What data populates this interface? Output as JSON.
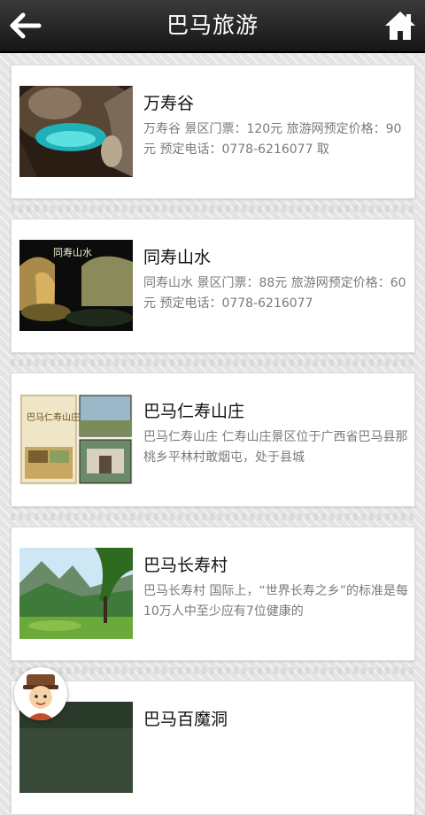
{
  "header": {
    "title": "巴马旅游"
  },
  "attractions": [
    {
      "name": "万寿谷",
      "description": "万寿谷 景区门票：120元 旅游网预定价格：90元 预定电话：0778-6216077 取"
    },
    {
      "name": "同寿山水",
      "description": "同寿山水 景区门票：88元 旅游网预定价格：60元 预定电话：0778-6216077"
    },
    {
      "name": "巴马仁寿山庄",
      "description": "巴马仁寿山庄 仁寿山庄景区位于广西省巴马县那桃乡平林村敢烟屯，处于县城"
    },
    {
      "name": "巴马长寿村",
      "description": "巴马长寿村 国际上，“世界长寿之乡”的标准是每10万人中至少应有7位健康的"
    },
    {
      "name": "巴马百魔洞",
      "description": ""
    }
  ],
  "thumb_texts": {
    "card2_logo": "同寿山水",
    "card3_sign": "巴马仁寿山庄"
  }
}
